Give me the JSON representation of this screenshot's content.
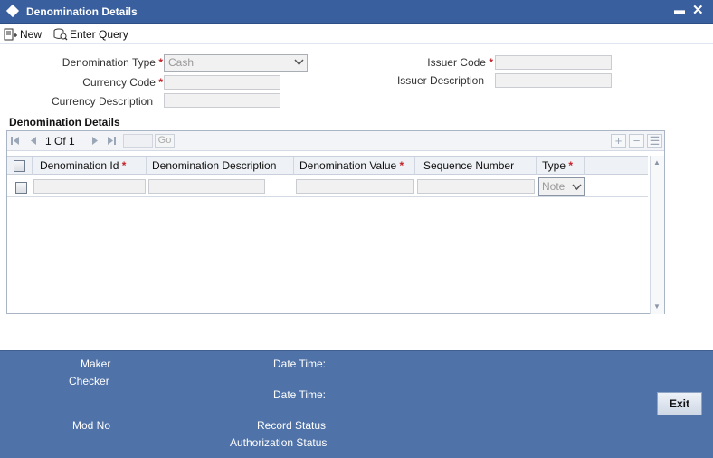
{
  "window": {
    "title": "Denomination Details",
    "minimize_glyph": "▬",
    "close_glyph": "✕"
  },
  "toolbar": {
    "new_label": "New",
    "enter_query_label": "Enter Query"
  },
  "form": {
    "denomination_type_label": "Denomination Type",
    "denomination_type_value": "Cash",
    "currency_code_label": "Currency Code",
    "currency_code_value": "",
    "currency_description_label": "Currency Description",
    "currency_description_value": "",
    "issuer_code_label": "Issuer Code",
    "issuer_code_value": "",
    "issuer_description_label": "Issuer Description",
    "issuer_description_value": "",
    "required_mark": "*"
  },
  "section": {
    "title": "Denomination Details"
  },
  "pager": {
    "page_text": "1 Of 1",
    "go_label": "Go",
    "add_glyph": "+",
    "remove_glyph": "−",
    "view_glyph": "☰"
  },
  "grid": {
    "columns": [
      {
        "label": "Denomination Id",
        "required": true
      },
      {
        "label": "Denomination Description",
        "required": false
      },
      {
        "label": "Denomination Value",
        "required": true
      },
      {
        "label": "Sequence Number",
        "required": false
      },
      {
        "label": "Type",
        "required": true
      }
    ],
    "row_type_value": "Note"
  },
  "footer": {
    "maker_label": "Maker",
    "checker_label": "Checker",
    "date_time_label_1": "Date Time:",
    "date_time_label_2": "Date Time:",
    "mod_no_label": "Mod No",
    "record_status_label": "Record Status",
    "authorization_status_label": "Authorization Status",
    "exit_label": "Exit"
  },
  "colors": {
    "titlebar": "#3a5f9e",
    "footer": "#4f72a8",
    "required": "#c4242b"
  }
}
